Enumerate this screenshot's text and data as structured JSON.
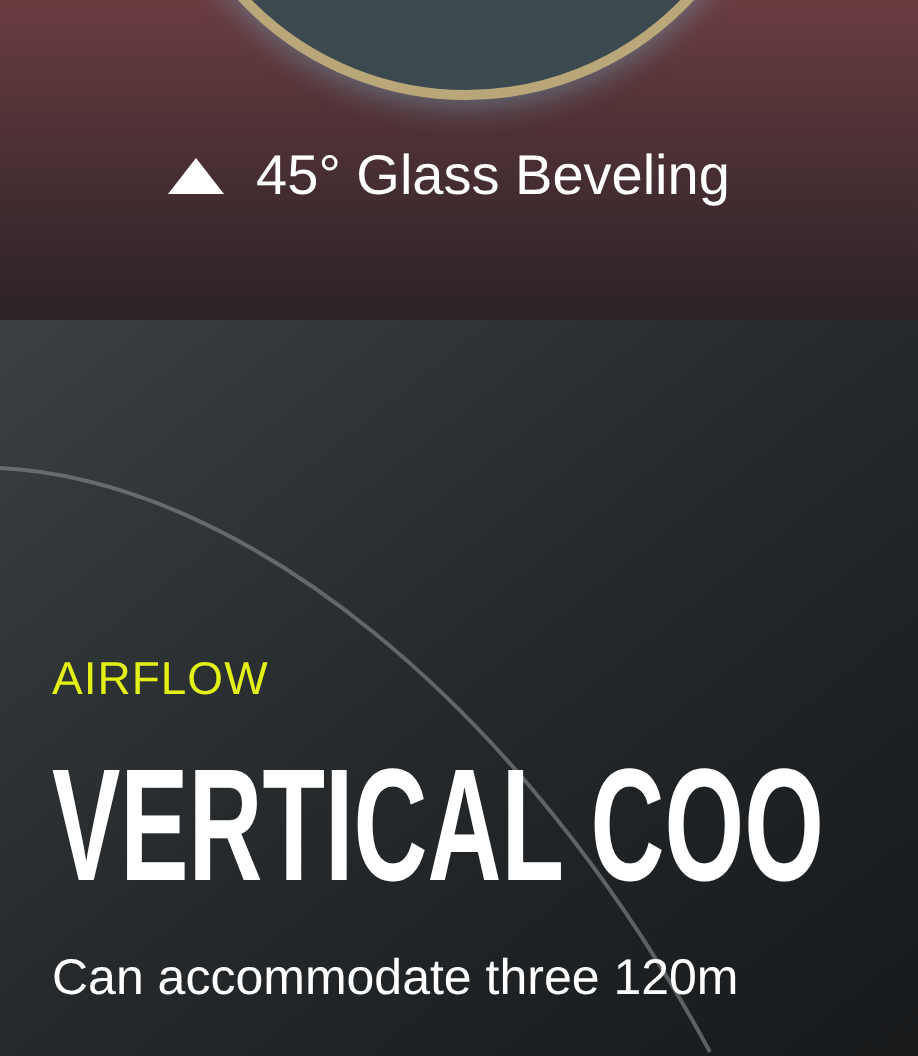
{
  "feature": {
    "caption": "45° Glass Beveling"
  },
  "section": {
    "eyebrow": "AIRFLOW",
    "heading": "VERTICAL COO",
    "body": "Can accommodate three 120m"
  }
}
